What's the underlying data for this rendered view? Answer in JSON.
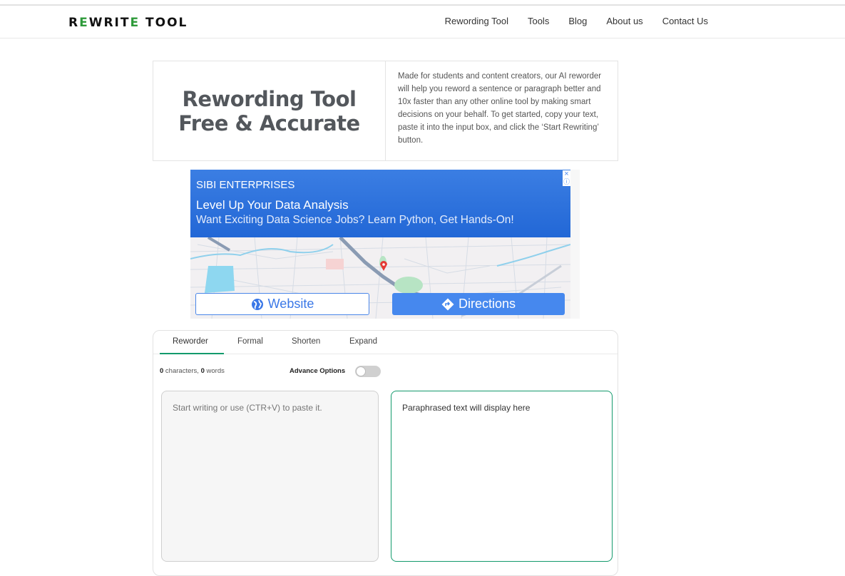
{
  "header": {
    "logo": {
      "part1": "R",
      "e1": "E",
      "part2": "WRIT",
      "e2": "E",
      "part3": " T",
      "o1": "O",
      "o2": "O",
      "part4": "L"
    },
    "nav": [
      "Rewording Tool",
      "Tools",
      "Blog",
      "About us",
      "Contact Us"
    ]
  },
  "hero": {
    "title_line1": "Rewording Tool",
    "title_line2": "Free & Accurate",
    "description": "Made for students and content creators, our AI reworder will help you reword a sentence or paragraph better and 10x faster than any other online tool by making smart decisions on your behalf. To get started, copy your text, paste it into the input box, and click the ‘Start Rewriting’ button."
  },
  "ad": {
    "brand": "SIBI ENTERPRISES",
    "headline": "Level Up Your Data Analysis",
    "subline": "Want Exciting Data Science Jobs? Learn Python, Get Hands-On!",
    "close_icon": "×",
    "info_icon": "ⓘ",
    "website_label": "Website",
    "directions_label": "Directions",
    "colors": {
      "banner": "#2a6fdc",
      "button": "#4688ee"
    }
  },
  "tool": {
    "tabs": [
      "Reworder",
      "Formal",
      "Shorten",
      "Expand"
    ],
    "active_tab": "Reworder",
    "char_count": "0",
    "char_label": " characters, ",
    "word_count": "0",
    "word_label": " words",
    "advance_options_label": "Advance Options",
    "advance_options_on": false,
    "input_placeholder": "Start writing or use (CTR+V) to paste it.",
    "input_value": "",
    "output_placeholder": "Paraphrased text will display here",
    "accent_color": "#139a6c"
  }
}
